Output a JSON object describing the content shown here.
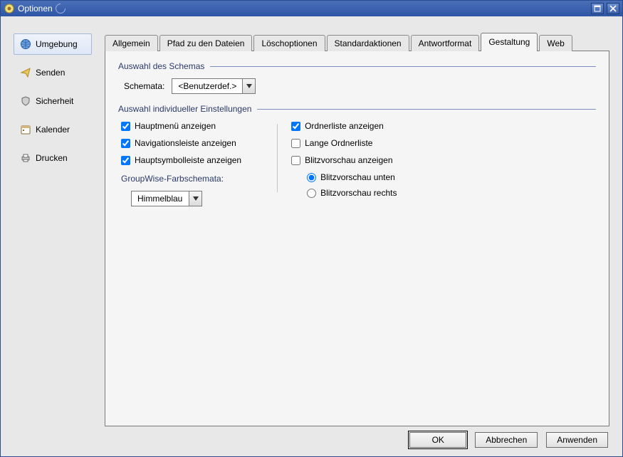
{
  "window": {
    "title": "Optionen"
  },
  "sidebar": {
    "items": [
      {
        "label": "Umgebung",
        "icon": "globe"
      },
      {
        "label": "Senden",
        "icon": "send"
      },
      {
        "label": "Sicherheit",
        "icon": "shield"
      },
      {
        "label": "Kalender",
        "icon": "calendar"
      },
      {
        "label": "Drucken",
        "icon": "printer"
      }
    ]
  },
  "tabs": {
    "items": [
      {
        "label": "Allgemein"
      },
      {
        "label": "Pfad zu den Dateien"
      },
      {
        "label": "Löschoptionen"
      },
      {
        "label": "Standardaktionen"
      },
      {
        "label": "Antwortformat"
      },
      {
        "label": "Gestaltung"
      },
      {
        "label": "Web"
      }
    ],
    "active_index": 5
  },
  "panel": {
    "group_schema_title": "Auswahl des Schemas",
    "schema_label": "Schemata:",
    "schema_value": "<Benutzerdef.>",
    "group_individual_title": "Auswahl individueller Einstellungen",
    "left": {
      "show_mainmenu": {
        "label": "Hauptmenü anzeigen",
        "checked": true
      },
      "show_navbar": {
        "label": "Navigationsleiste anzeigen",
        "checked": true
      },
      "show_toolbar": {
        "label": "Hauptsymbolleiste anzeigen",
        "checked": true
      },
      "colorscheme_label": "GroupWise-Farbschemata:",
      "colorscheme_value": "Himmelblau"
    },
    "right": {
      "show_folderlist": {
        "label": "Ordnerliste anzeigen",
        "checked": true
      },
      "long_folderlist": {
        "label": "Lange Ordnerliste",
        "checked": false
      },
      "show_quickview": {
        "label": "Blitzvorschau anzeigen",
        "checked": false
      },
      "quickview_pos": {
        "options": [
          {
            "label": "Blitzvorschau unten",
            "value": "bottom"
          },
          {
            "label": "Blitzvorschau rechts",
            "value": "right"
          }
        ],
        "selected": "bottom"
      }
    }
  },
  "buttons": {
    "ok": "OK",
    "cancel": "Abbrechen",
    "apply": "Anwenden"
  }
}
